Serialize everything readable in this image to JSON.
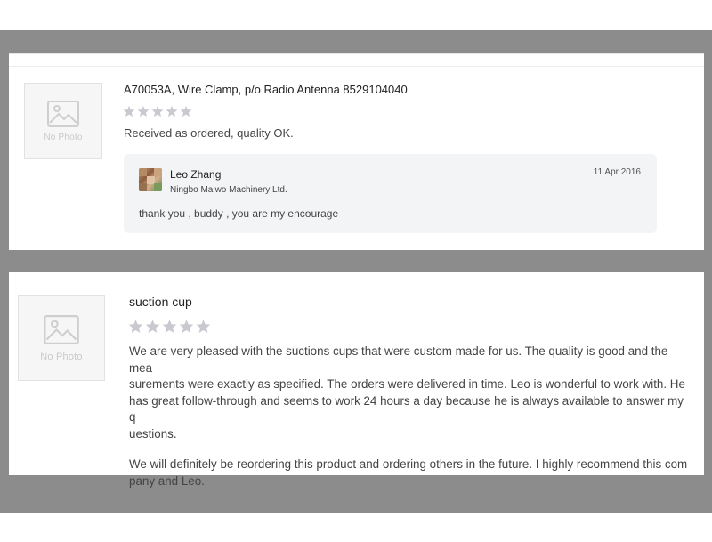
{
  "reviews": [
    {
      "photo_label": "No Photo",
      "title": "A70053A, Wire Clamp, p/o Radio Antenna 8529104040",
      "rating": 0,
      "max_rating": 5,
      "comment": "Received as ordered, quality OK.",
      "reply": {
        "name": "Leo Zhang",
        "company": "Ningbo Maiwo Machinery Ltd.",
        "date": "11 Apr 2016",
        "text": "thank you , buddy , you are my encourage"
      }
    },
    {
      "photo_label": "No Photo",
      "title": "suction cup",
      "rating": 0,
      "max_rating": 5,
      "paragraphs": [
        "We are very pleased with the suctions cups that were custom made for us. The quality is good and the mea\nsurements were exactly as specified.  The orders were delivered in time. Leo is wonderful to work with. He\nhas great follow-through and seems to work 24 hours a day because he is always available to answer my q\nuestions.",
        "We will definitely be reordering  this product and ordering others in the future. I highly recommend this com\npany and Leo."
      ]
    }
  ],
  "colors": {
    "frame": "#8c8c8c",
    "star_empty": "#c8cad0",
    "reply_bg": "#f3f4f6"
  }
}
